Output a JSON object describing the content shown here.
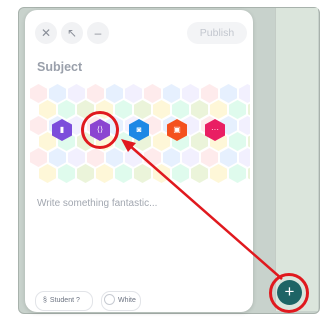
{
  "toolbar": {
    "close_glyph": "✕",
    "collapse_glyph": "↖",
    "minimize_glyph": "–",
    "publish_label": "Publish"
  },
  "compose": {
    "subject_placeholder": "Subject",
    "body_placeholder": "Write something fantastic..."
  },
  "app_icons": [
    {
      "name": "document",
      "color": "#7c4ddb",
      "glyph": "▮"
    },
    {
      "name": "link",
      "color": "#8b45d1",
      "glyph": "⟨⟩"
    },
    {
      "name": "camera",
      "color": "#1e88e5",
      "glyph": "◙"
    },
    {
      "name": "gallery",
      "color": "#f4511e",
      "glyph": "▣"
    },
    {
      "name": "more",
      "color": "#e91e63",
      "glyph": "···"
    }
  ],
  "chips": {
    "student_glyph": "§",
    "student_label": "Student ?",
    "white_label": "White"
  },
  "fab": {
    "glyph": "+"
  },
  "colors": {
    "accent_red": "#e0191e",
    "fab_teal": "#1e6465",
    "pattern_colors": [
      "#fde2e4",
      "#e2f0cb",
      "#dbeafe",
      "#fef3c7",
      "#ede9fe",
      "#d1fae5"
    ]
  }
}
